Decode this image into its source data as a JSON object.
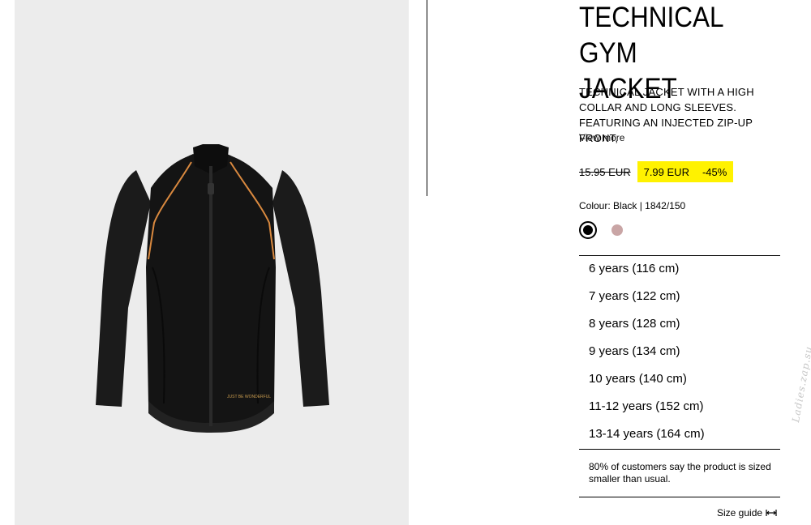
{
  "product": {
    "title_line1": "TECHNICAL GYM",
    "title_line2": "JACKET",
    "description_lines": [
      "TECHNICAL JACKET WITH A HIGH",
      "COLLAR AND LONG SLEEVES.",
      "FEATURING AN INJECTED ZIP-UP FRONT,"
    ],
    "view_more": "View more",
    "image_print_text": "JUST BE WONDERFUL"
  },
  "price": {
    "original": "15.95 EUR",
    "current": "7.99 EUR",
    "discount": "-45%",
    "highlight_color": "#fff200"
  },
  "colour": {
    "line": "Colour: Black | 1842/150",
    "swatches": [
      {
        "name": "black",
        "color": "#000000",
        "selected": true
      },
      {
        "name": "pink",
        "color": "#c9a5a5",
        "selected": false
      }
    ]
  },
  "sizes": [
    "6 years (116 cm)",
    "7 years (122 cm)",
    "8 years (128 cm)",
    "9 years (134 cm)",
    "10 years (140 cm)",
    "11-12 years (152 cm)",
    "13-14 years (164 cm)"
  ],
  "fit_note": "80% of customers say the product is sized smaller than usual.",
  "size_guide": {
    "label": "Size guide",
    "icon": "ruler-arrows-icon"
  },
  "watermark": "Ladies.zap.su"
}
